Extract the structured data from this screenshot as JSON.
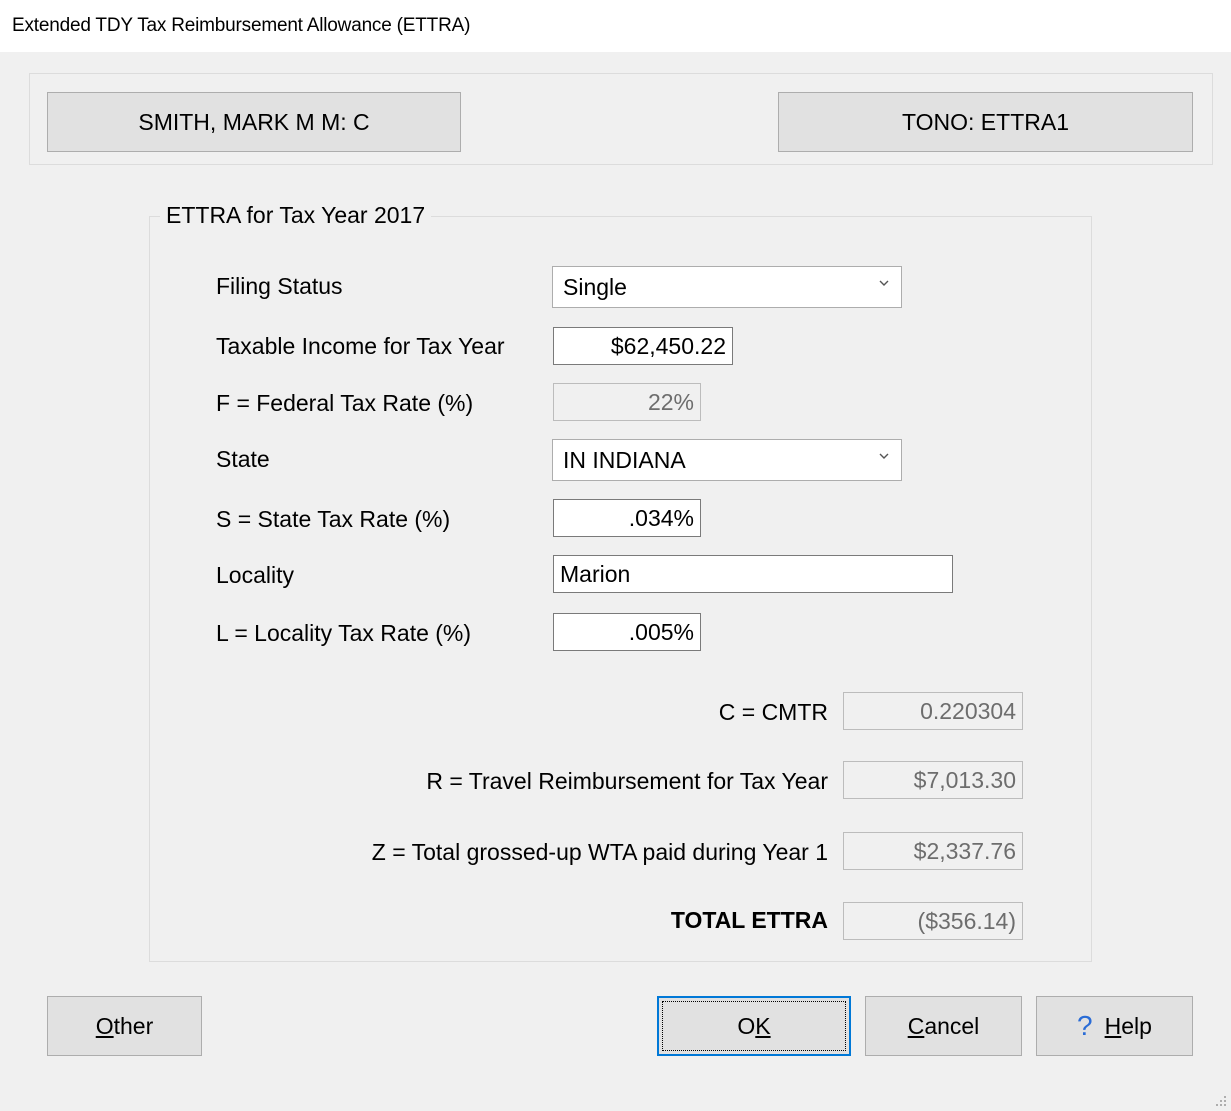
{
  "window": {
    "title": "Extended TDY Tax Reimbursement Allowance (ETTRA)"
  },
  "header": {
    "name": "SMITH, MARK M M: C",
    "tono": "TONO: ETTRA1"
  },
  "group": {
    "title": "ETTRA for Tax Year 2017"
  },
  "form": {
    "filing_status": {
      "label": "Filing Status",
      "value": "Single"
    },
    "taxable_income": {
      "label": "Taxable Income for Tax Year",
      "value": "$62,450.22"
    },
    "federal_rate": {
      "label": "F = Federal Tax Rate (%)",
      "value": "22%"
    },
    "state": {
      "label": "State",
      "value": "IN INDIANA"
    },
    "state_rate": {
      "label": "S = State Tax Rate (%)",
      "value": ".034%"
    },
    "locality": {
      "label": "Locality",
      "value": "Marion"
    },
    "locality_rate": {
      "label": "L = Locality Tax Rate (%)",
      "value": ".005%"
    }
  },
  "results": {
    "cmtr": {
      "label": "C = CMTR",
      "value": "0.220304"
    },
    "reimbursement": {
      "label": "R = Travel Reimbursement for Tax Year",
      "value": "$7,013.30"
    },
    "wta": {
      "label": "Z = Total grossed-up WTA paid during Year 1",
      "value": "$2,337.76"
    },
    "total": {
      "label": "TOTAL ETTRA",
      "value": "($356.14)"
    }
  },
  "buttons": {
    "other": {
      "first": "O",
      "rest": "ther"
    },
    "ok": {
      "first": "O",
      "rest": "K"
    },
    "cancel": {
      "first": "C",
      "rest": "ancel"
    },
    "help": {
      "first": "H",
      "rest": "elp"
    }
  },
  "icons": {
    "chevron": "chevron-down-icon",
    "help": "help-icon",
    "grip": "resize-grip-icon"
  }
}
